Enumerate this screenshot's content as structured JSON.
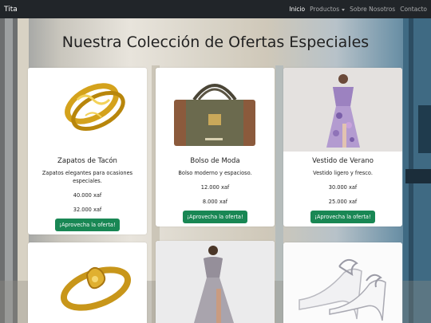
{
  "navbar": {
    "brand": "Tita",
    "links": [
      {
        "label": "Inicio",
        "active": true
      },
      {
        "label": "Productos",
        "dropdown": true
      },
      {
        "label": "Sobre Nosotros"
      },
      {
        "label": "Contacto"
      }
    ]
  },
  "page_title": "Nuestra Colección de Ofertas Especiales",
  "products": [
    {
      "title": "Zapatos de Tacón",
      "description": "Zapatos elegantes para ocasiones especiales.",
      "old_price": "40.000 xaf",
      "new_price": "32.000 xaf",
      "button": "¡Aprovecha la oferta!",
      "image": "gold-ring"
    },
    {
      "title": "Bolso de Moda",
      "description": "Bolso moderno y espacioso.",
      "old_price": "12.000 xaf",
      "new_price": "8.000 xaf",
      "button": "¡Aprovecha la oferta!",
      "image": "brown-handbag"
    },
    {
      "title": "Vestido de Verano",
      "description": "Vestido ligero y fresco.",
      "old_price": "30.000 xaf",
      "new_price": "25.000 xaf",
      "button": "¡Aprovecha la oferta!",
      "image": "floral-dress"
    },
    {
      "image": "gold-ring-ornate"
    },
    {
      "image": "grey-gown"
    },
    {
      "image": "silver-heels"
    }
  ],
  "colors": {
    "navbar": "#212529",
    "button": "#198754",
    "card": "#ffffff"
  }
}
